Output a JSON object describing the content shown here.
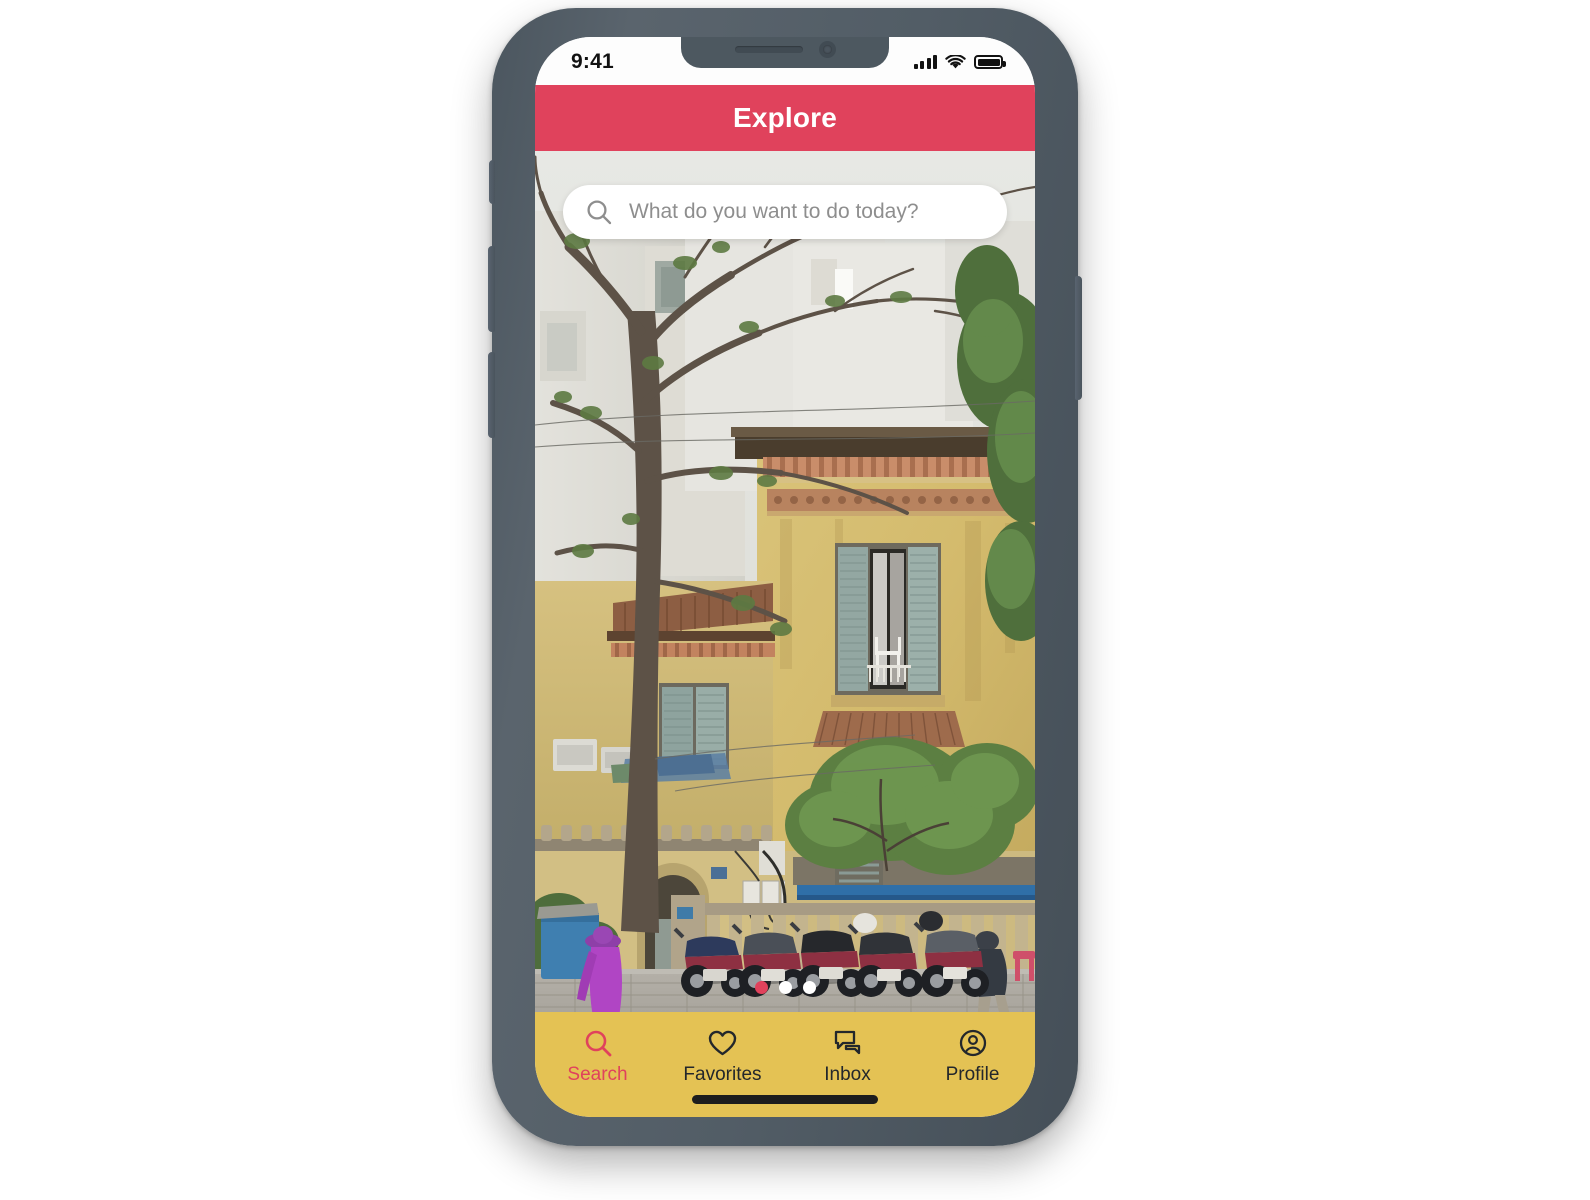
{
  "device": {
    "name": "smartphone-mockup",
    "frame_color": "#4f5a63",
    "notch": {
      "speaker": "speaker-slot",
      "camera": "front-camera"
    },
    "buttons": [
      "silent-switch",
      "volume-up",
      "volume-down",
      "power"
    ]
  },
  "status_bar": {
    "time": "9:41",
    "cellular_icon": "signal-bars-icon",
    "wifi_icon": "wifi-icon",
    "battery_icon": "battery-full-icon"
  },
  "header": {
    "title": "Explore",
    "background": "#e0425c",
    "text_color": "#ffffff"
  },
  "search": {
    "placeholder": "What do you want to do today?",
    "value": "",
    "icon": "search-icon"
  },
  "hero": {
    "alt": "Street scene with weathered yellow colonial building, bare tree, parked motorbikes and a person in a purple jacket walking on the sidewalk",
    "carousel": {
      "total": 3,
      "active_index": 0,
      "active_color": "#e0425c",
      "inactive_color": "#ffffff"
    }
  },
  "tab_bar": {
    "background": "#e4c254",
    "active_color": "#e0425c",
    "inactive_color": "#23272b",
    "active_index": 0,
    "items": [
      {
        "label": "Search",
        "icon": "search-icon"
      },
      {
        "label": "Favorites",
        "icon": "heart-icon"
      },
      {
        "label": "Inbox",
        "icon": "chat-bubbles-icon"
      },
      {
        "label": "Profile",
        "icon": "account-circle-icon"
      }
    ]
  },
  "home_indicator": {
    "name": "home-indicator",
    "color": "#1d1d1d"
  }
}
